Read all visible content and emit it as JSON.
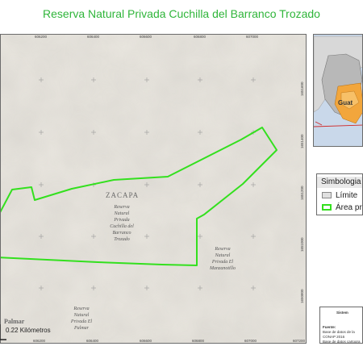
{
  "title": "Reserva Natural Privada Cuchilla del Barranco Trozado",
  "map": {
    "region_label": "ZACAPA",
    "area_labels": [
      {
        "id": "cuchilla",
        "text": "Reserva\nNatural\nPrivada\nCuchilla del\nBarranco\nTrozado"
      },
      {
        "id": "manzanotillo",
        "text": "Reserva\nNatural\nPrivada El\nManzanotillo"
      },
      {
        "id": "palmar",
        "text": "Reserva\nNatural\nPrivada El\nPalmar"
      },
      {
        "id": "palmar_top",
        "text": "Palmar"
      }
    ],
    "x_ticks_top": [
      "606200",
      "606400",
      "606600",
      "606800",
      "607000"
    ],
    "x_ticks_bottom": [
      "606200",
      "606400",
      "606600",
      "606800",
      "607000",
      "607200"
    ],
    "y_ticks_right": [
      "1651600",
      "1651400",
      "1651200",
      "1651000",
      "1650800"
    ],
    "colors": {
      "boundary": "#33e01e",
      "relief": "#e9e6df",
      "grid_marks": "#9a9a9a"
    },
    "scale_label": "0.22 Kilómetros"
  },
  "inset": {
    "label_partial": "Guat",
    "colors": {
      "water": "#c9d8ea",
      "country": "#b8b8b8",
      "department": "#f2a63c",
      "pointer": "#cf2b2b"
    }
  },
  "legend": {
    "title": "Simbologia",
    "items": [
      {
        "label": "Límite",
        "swatch_color": "#e0e0e0",
        "border_color": "#888888"
      },
      {
        "label": "Área pr",
        "swatch_color": "#ffffff",
        "border_color": "#33e01e"
      }
    ]
  },
  "info": {
    "header": "Sistem",
    "source_label": "Fuente:",
    "lines": [
      "Base de datos de la",
      "CONAP 2016",
      "Base de datos cartogra"
    ]
  }
}
